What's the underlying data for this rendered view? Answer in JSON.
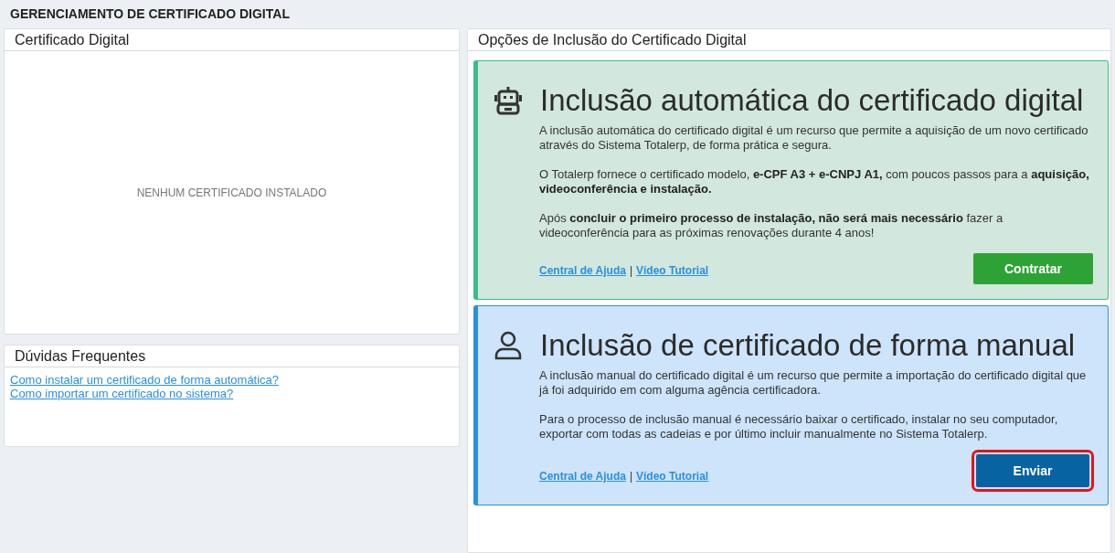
{
  "page_title": "GERENCIAMENTO DE CERTIFICADO DIGITAL",
  "certificate_panel": {
    "title": "Certificado Digital",
    "empty_message": "NENHUM CERTIFICADO INSTALADO"
  },
  "faq_panel": {
    "title": "Dúvidas Frequentes",
    "links": [
      "Como instalar um certificado de forma automática?",
      "Como importar um certificado no sistema?"
    ]
  },
  "options_panel": {
    "title": "Opções de Inclusão do Certificado Digital",
    "options": [
      {
        "kind": "automatic",
        "title": "Inclusão automática do certificado digital",
        "paragraphs": [
          "A inclusão automática do certificado digital é um recurso que permite a aquisição de um novo certificado através do Sistema Totalerp, de forma prática e segura.",
          "O Totalerp fornece o certificado modelo, **e-CPF A3 + e-CNPJ A1,** com poucos passos para a **aquisição, videoconferência e instalação.**",
          "Após **concluir o primeiro processo de instalação, não será mais necessário** fazer a videoconferência para as próximas renovações durante 4 anos!"
        ],
        "links": [
          "Central de Ajuda",
          "Vídeo Tutorial"
        ],
        "separator": "|",
        "button": {
          "label": "Contratar",
          "highlighted": false
        }
      },
      {
        "kind": "manual",
        "title": "Inclusão de certificado de forma manual",
        "paragraphs": [
          "A inclusão manual do certificado digital é um recurso que permite a importação do certificado digital que já foi adquirido em com alguma agência certificadora.",
          "Para o processo de inclusão manual é necessário baixar o certificado, instalar no seu computador, exportar com todas as cadeias e por último incluir manualmente no Sistema Totalerp."
        ],
        "links": [
          "Central de Ajuda",
          "Vídeo Tutorial"
        ],
        "separator": "|",
        "button": {
          "label": "Enviar",
          "highlighted": true
        }
      }
    ]
  }
}
